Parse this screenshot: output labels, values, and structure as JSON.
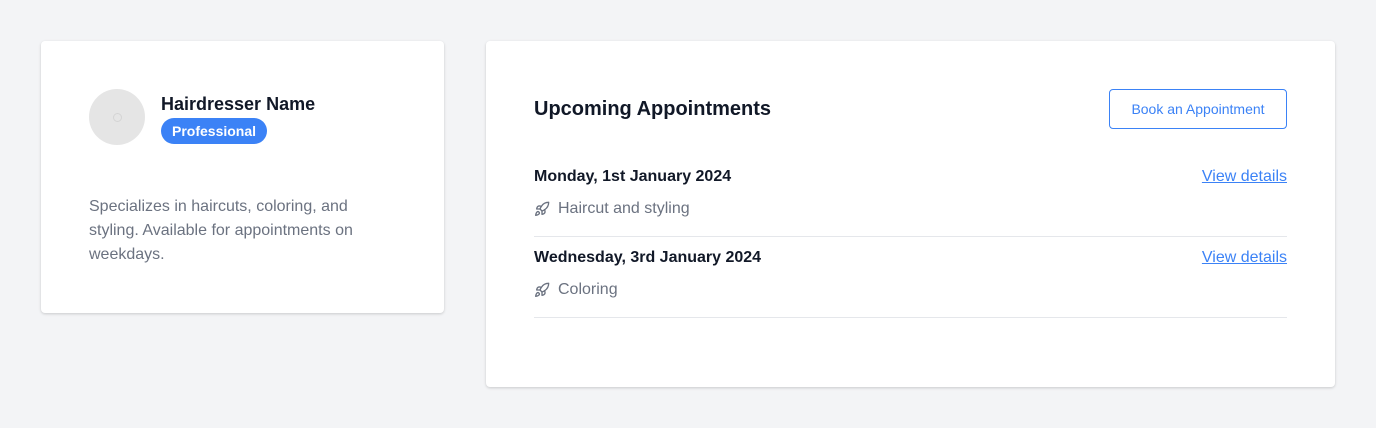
{
  "profile": {
    "name": "Hairdresser Name",
    "badge": "Professional",
    "bio": "Specializes in haircuts, coloring, and styling. Available for appointments on weekdays."
  },
  "appointments": {
    "title": "Upcoming Appointments",
    "book_label": "Book an Appointment",
    "items": [
      {
        "date": "Monday, 1st January 2024",
        "service": "Haircut and styling",
        "link": "View details",
        "icon": "rocket-icon"
      },
      {
        "date": "Wednesday, 3rd January 2024",
        "service": "Coloring",
        "link": "View details",
        "icon": "rocket-icon"
      }
    ]
  },
  "colors": {
    "accent": "#3b82f6",
    "background": "#f3f4f6",
    "muted_text": "#6b7280"
  }
}
